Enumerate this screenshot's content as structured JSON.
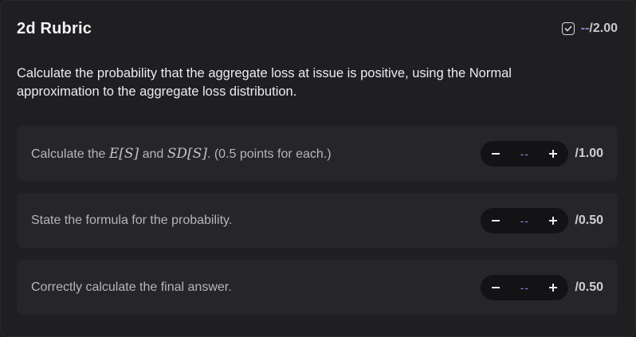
{
  "rubric": {
    "title": "2d Rubric",
    "total_score": "--",
    "total_max": "/2.00",
    "icon": "checkbox-icon"
  },
  "question": "Calculate the probability that the aggregate loss at issue is positive, using the Normal approximation to the aggregate loss distribution.",
  "criteria": [
    {
      "text_pre": "Calculate the ",
      "math_1": "E[S]",
      "text_mid": " and ",
      "math_2": "SD[S]",
      "text_post": ". (0.5 points for each.)",
      "score": "--",
      "max": "/1.00"
    },
    {
      "text": "State the formula for the probability.",
      "score": "--",
      "max": "/0.50"
    },
    {
      "text": "Correctly calculate the final answer.",
      "score": "--",
      "max": "/0.50"
    }
  ],
  "colors": {
    "accent": "#8e88d6",
    "background": "#1f1f21",
    "card": "#262629",
    "stepper": "#131315"
  }
}
